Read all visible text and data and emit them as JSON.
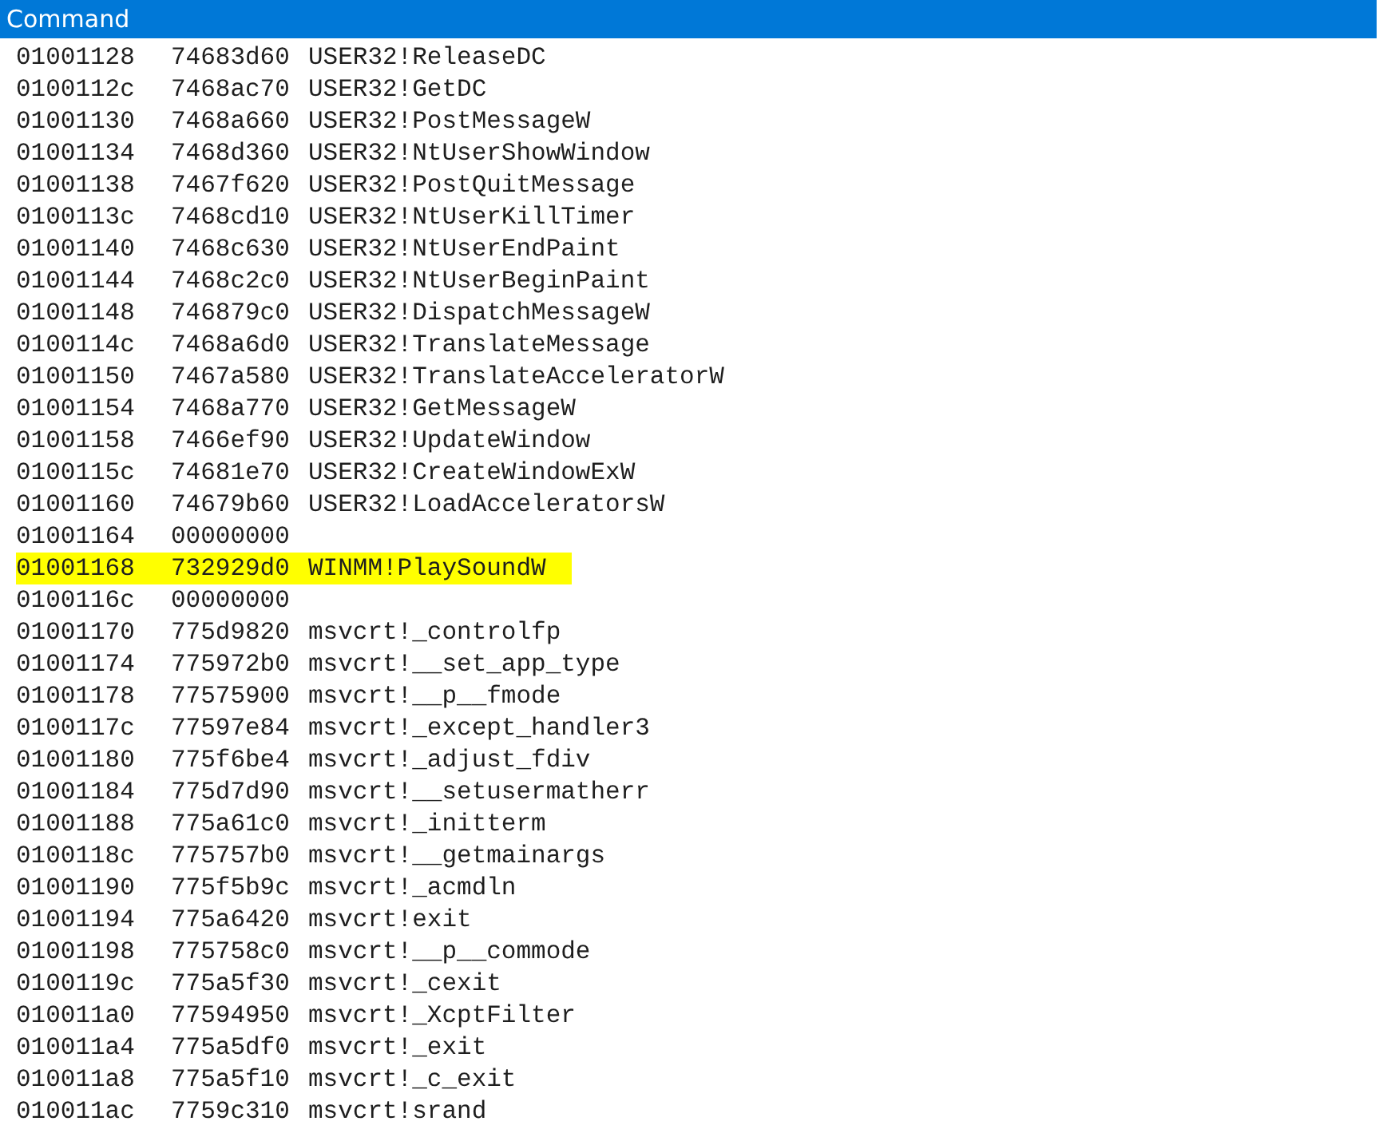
{
  "window": {
    "title": "Command"
  },
  "rows": [
    {
      "address": "01001128",
      "value": "74683d60",
      "symbol": "USER32!ReleaseDC",
      "highlighted": false
    },
    {
      "address": "0100112c",
      "value": "7468ac70",
      "symbol": "USER32!GetDC",
      "highlighted": false
    },
    {
      "address": "01001130",
      "value": "7468a660",
      "symbol": "USER32!PostMessageW",
      "highlighted": false
    },
    {
      "address": "01001134",
      "value": "7468d360",
      "symbol": "USER32!NtUserShowWindow",
      "highlighted": false
    },
    {
      "address": "01001138",
      "value": "7467f620",
      "symbol": "USER32!PostQuitMessage",
      "highlighted": false
    },
    {
      "address": "0100113c",
      "value": "7468cd10",
      "symbol": "USER32!NtUserKillTimer",
      "highlighted": false
    },
    {
      "address": "01001140",
      "value": "7468c630",
      "symbol": "USER32!NtUserEndPaint",
      "highlighted": false
    },
    {
      "address": "01001144",
      "value": "7468c2c0",
      "symbol": "USER32!NtUserBeginPaint",
      "highlighted": false
    },
    {
      "address": "01001148",
      "value": "746879c0",
      "symbol": "USER32!DispatchMessageW",
      "highlighted": false
    },
    {
      "address": "0100114c",
      "value": "7468a6d0",
      "symbol": "USER32!TranslateMessage",
      "highlighted": false
    },
    {
      "address": "01001150",
      "value": "7467a580",
      "symbol": "USER32!TranslateAcceleratorW",
      "highlighted": false
    },
    {
      "address": "01001154",
      "value": "7468a770",
      "symbol": "USER32!GetMessageW",
      "highlighted": false
    },
    {
      "address": "01001158",
      "value": "7466ef90",
      "symbol": "USER32!UpdateWindow",
      "highlighted": false
    },
    {
      "address": "0100115c",
      "value": "74681e70",
      "symbol": "USER32!CreateWindowExW",
      "highlighted": false
    },
    {
      "address": "01001160",
      "value": "74679b60",
      "symbol": "USER32!LoadAcceleratorsW",
      "highlighted": false
    },
    {
      "address": "01001164",
      "value": "00000000",
      "highlighted": false
    },
    {
      "address": "01001168",
      "value": "732929d0",
      "symbol": "WINMM!PlaySoundW",
      "highlighted": true
    },
    {
      "address": "0100116c",
      "value": "00000000",
      "highlighted": false
    },
    {
      "address": "01001170",
      "value": "775d9820",
      "symbol": "msvcrt!_controlfp",
      "highlighted": false
    },
    {
      "address": "01001174",
      "value": "775972b0",
      "symbol": "msvcrt!__set_app_type",
      "highlighted": false
    },
    {
      "address": "01001178",
      "value": "77575900",
      "symbol": "msvcrt!__p__fmode",
      "highlighted": false
    },
    {
      "address": "0100117c",
      "value": "77597e84",
      "symbol": "msvcrt!_except_handler3",
      "highlighted": false
    },
    {
      "address": "01001180",
      "value": "775f6be4",
      "symbol": "msvcrt!_adjust_fdiv",
      "highlighted": false
    },
    {
      "address": "01001184",
      "value": "775d7d90",
      "symbol": "msvcrt!__setusermatherr",
      "highlighted": false
    },
    {
      "address": "01001188",
      "value": "775a61c0",
      "symbol": "msvcrt!_initterm",
      "highlighted": false
    },
    {
      "address": "0100118c",
      "value": "775757b0",
      "symbol": "msvcrt!__getmainargs",
      "highlighted": false
    },
    {
      "address": "01001190",
      "value": "775f5b9c",
      "symbol": "msvcrt!_acmdln",
      "highlighted": false
    },
    {
      "address": "01001194",
      "value": "775a6420",
      "symbol": "msvcrt!exit",
      "highlighted": false
    },
    {
      "address": "01001198",
      "value": "775758c0",
      "symbol": "msvcrt!__p__commode",
      "highlighted": false
    },
    {
      "address": "0100119c",
      "value": "775a5f30",
      "symbol": "msvcrt!_cexit",
      "highlighted": false
    },
    {
      "address": "010011a0",
      "value": "77594950",
      "symbol": "msvcrt!_XcptFilter",
      "highlighted": false
    },
    {
      "address": "010011a4",
      "value": "775a5df0",
      "symbol": "msvcrt!_exit",
      "highlighted": false
    },
    {
      "address": "010011a8",
      "value": "775a5f10",
      "symbol": "msvcrt!_c_exit",
      "highlighted": false
    },
    {
      "address": "010011ac",
      "value": "7759c310",
      "symbol": "msvcrt!srand",
      "highlighted": false
    }
  ]
}
